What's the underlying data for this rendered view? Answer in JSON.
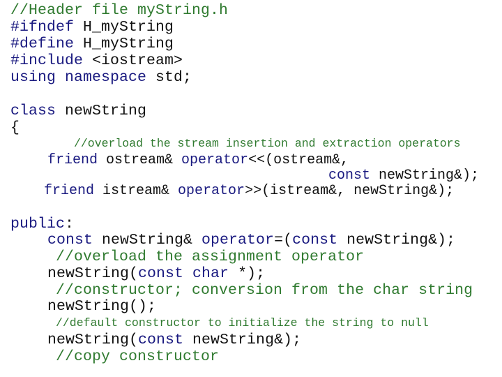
{
  "document": {
    "filename": "myString.h",
    "colors": {
      "keyword": "#1a1a80",
      "identifier": "#111111",
      "comment": "#2f7a2f",
      "background": "#ffffff"
    },
    "lines": [
      {
        "tokens": [
          {
            "type": "comment",
            "text": "//Header file myString.h"
          }
        ]
      },
      {
        "tokens": [
          {
            "type": "keyword",
            "text": "#ifndef "
          },
          {
            "type": "identifier",
            "text": "H_myString"
          }
        ]
      },
      {
        "tokens": [
          {
            "type": "keyword",
            "text": "#define "
          },
          {
            "type": "identifier",
            "text": "H_myString"
          }
        ]
      },
      {
        "tokens": [
          {
            "type": "keyword",
            "text": "#include "
          },
          {
            "type": "identifier",
            "text": "<iostream>"
          }
        ]
      },
      {
        "tokens": [
          {
            "type": "keyword",
            "text": "using namespace "
          },
          {
            "type": "identifier",
            "text": "std;"
          }
        ]
      },
      {
        "tokens": [
          {
            "type": "keyword",
            "text": "class "
          },
          {
            "type": "identifier",
            "text": "newString"
          }
        ]
      },
      {
        "tokens": [
          {
            "type": "identifier",
            "text": "{"
          }
        ]
      },
      {
        "tokens": [
          {
            "type": "comment",
            "text": "//overload the stream insertion and extraction operators"
          }
        ]
      },
      {
        "tokens": [
          {
            "type": "keyword",
            "text": "friend "
          },
          {
            "type": "identifier",
            "text": "ostream& "
          },
          {
            "type": "keyword",
            "text": "operator"
          },
          {
            "type": "identifier",
            "text": "<<(ostream&,"
          }
        ]
      },
      {
        "tokens": [
          {
            "type": "keyword",
            "text": "const "
          },
          {
            "type": "identifier",
            "text": "newString&);"
          }
        ]
      },
      {
        "tokens": [
          {
            "type": "keyword",
            "text": "friend "
          },
          {
            "type": "identifier",
            "text": "istream& "
          },
          {
            "type": "keyword",
            "text": "operator"
          },
          {
            "type": "identifier",
            "text": ">>(istream&, newString&);"
          }
        ]
      },
      {
        "tokens": [
          {
            "type": "keyword",
            "text": "public"
          },
          {
            "type": "identifier",
            "text": ":"
          }
        ]
      },
      {
        "tokens": [
          {
            "type": "keyword",
            "text": "const "
          },
          {
            "type": "identifier",
            "text": "newString& "
          },
          {
            "type": "keyword",
            "text": "operator"
          },
          {
            "type": "identifier",
            "text": "=("
          },
          {
            "type": "keyword",
            "text": "const "
          },
          {
            "type": "identifier",
            "text": "newString&);"
          }
        ]
      },
      {
        "tokens": [
          {
            "type": "comment",
            "text": "//overload the assignment operator"
          }
        ]
      },
      {
        "tokens": [
          {
            "type": "identifier",
            "text": "newString("
          },
          {
            "type": "keyword",
            "text": "const char "
          },
          {
            "type": "identifier",
            "text": "*);"
          }
        ]
      },
      {
        "tokens": [
          {
            "type": "comment",
            "text": "//constructor; conversion from the char string"
          }
        ]
      },
      {
        "tokens": [
          {
            "type": "identifier",
            "text": "newString();"
          }
        ]
      },
      {
        "tokens": [
          {
            "type": "comment",
            "text": "//default constructor to initialize the string to null"
          }
        ]
      },
      {
        "tokens": [
          {
            "type": "identifier",
            "text": "newString("
          },
          {
            "type": "keyword",
            "text": "const "
          },
          {
            "type": "identifier",
            "text": "newString&);"
          }
        ]
      },
      {
        "tokens": [
          {
            "type": "comment",
            "text": "//copy constructor"
          }
        ]
      }
    ]
  }
}
